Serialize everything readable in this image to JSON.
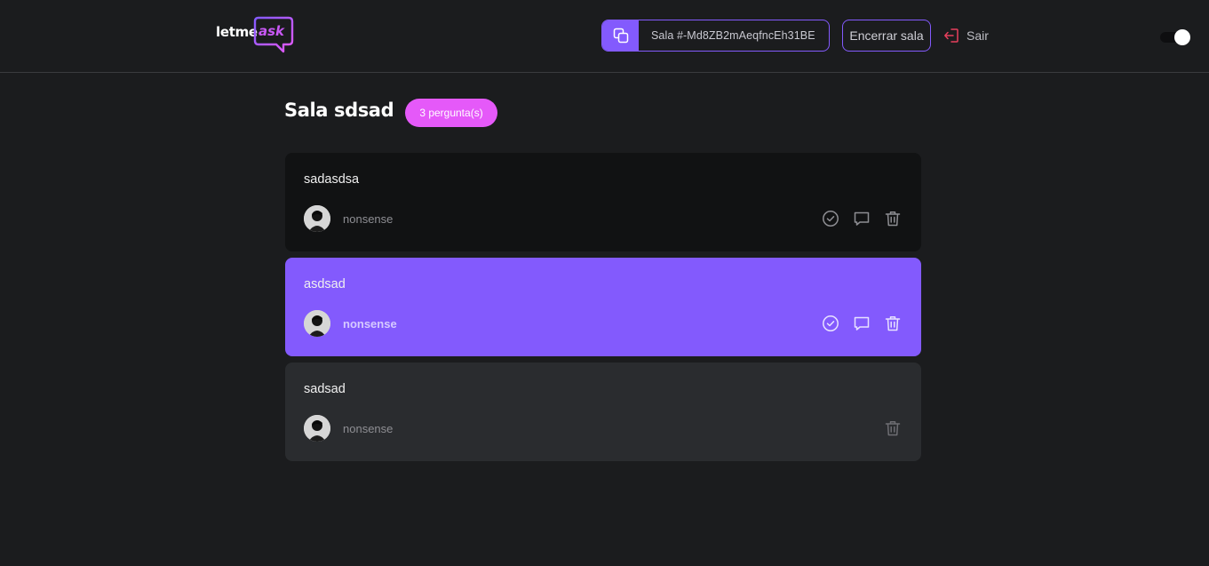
{
  "header": {
    "logo": {
      "word_letme": "letme",
      "word_ask": "ask",
      "ask_color": "#c858f5"
    },
    "room_code_label": "Sala #-Md8ZB2mAeqfncEh31BE",
    "close_room_label": "Encerrar sala",
    "logout_label": "Sair",
    "theme_toggle": {
      "state": "on"
    }
  },
  "main": {
    "room_title": "Sala sdsad",
    "question_count_label": "3 pergunta(s)"
  },
  "questions": [
    {
      "text": "sadasdsa",
      "author": "nonsense",
      "state": "default",
      "icons": [
        "check-circle-icon",
        "comment-icon",
        "trash-icon"
      ]
    },
    {
      "text": "asdsad",
      "author": "nonsense",
      "state": "highlighted",
      "icons": [
        "check-circle-icon",
        "comment-icon",
        "trash-icon"
      ]
    },
    {
      "text": "sadsad",
      "author": "nonsense",
      "state": "answered",
      "icons": [
        "trash-icon"
      ]
    }
  ],
  "colors": {
    "accent": "#835afd",
    "badge": "#e559f9",
    "logout": "#e73f5d",
    "background": "#1b1c1e"
  }
}
